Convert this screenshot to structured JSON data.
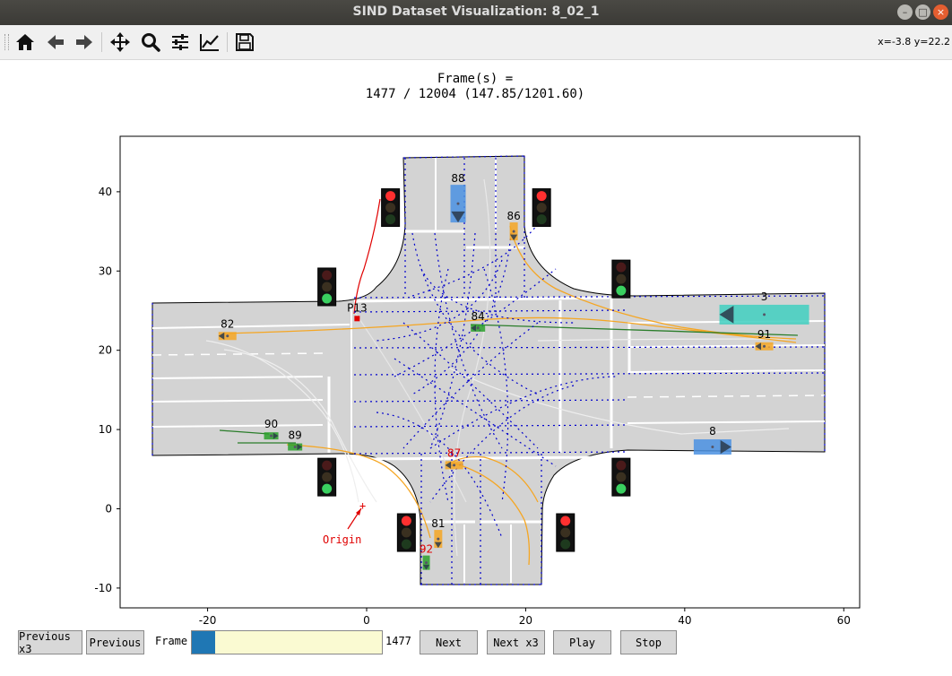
{
  "window": {
    "title": "SIND Dataset Visualization: 8_02_1"
  },
  "toolbar": {
    "tools": [
      {
        "name": "home-icon"
      },
      {
        "name": "back-icon"
      },
      {
        "name": "forward-icon"
      },
      {
        "name": "pan-icon"
      },
      {
        "name": "zoom-icon"
      },
      {
        "name": "configure-subplots-icon"
      },
      {
        "name": "edit-axis-icon"
      },
      {
        "name": "save-icon"
      }
    ],
    "coords": "x=-3.8 y=22.2"
  },
  "plot": {
    "title_line1": "Frame(s) =",
    "title_line2": "1477 / 12004 (147.85/1201.60)",
    "xlim": [
      -31,
      62
    ],
    "ylim": [
      -12.5,
      47
    ],
    "xticks": [
      "-20",
      "0",
      "20",
      "40",
      "60"
    ],
    "yticks": [
      "40",
      "30",
      "20",
      "10",
      "0",
      "-10"
    ],
    "origin_label": "Origin",
    "colors": {
      "car": "#4a90e2",
      "truck": "#40cfc0",
      "moto": "#f5a623",
      "bike": "#2ca02c",
      "ped": "#e00000",
      "road": "#d3d3d3",
      "lane": "#0000cc"
    },
    "vehicles": [
      {
        "id": "88",
        "x": 11.5,
        "y": 38.5,
        "type": "car",
        "dir": "down"
      },
      {
        "id": "86",
        "x": 18.5,
        "y": 35,
        "type": "moto",
        "dir": "down"
      },
      {
        "id": "3",
        "x": 50,
        "y": 24.5,
        "type": "truck",
        "dir": "left"
      },
      {
        "id": "91",
        "x": 50,
        "y": 20.5,
        "type": "moto",
        "dir": "left"
      },
      {
        "id": "84",
        "x": 14,
        "y": 22.8,
        "type": "bike",
        "dir": "left"
      },
      {
        "id": "82",
        "x": -17.5,
        "y": 21.8,
        "type": "moto",
        "dir": "left"
      },
      {
        "id": "P13",
        "x": -1.2,
        "y": 24,
        "type": "ped",
        "dir": "none"
      },
      {
        "id": "90",
        "x": -12,
        "y": 9.2,
        "type": "bike",
        "dir": "right"
      },
      {
        "id": "89",
        "x": -9,
        "y": 7.8,
        "type": "bike",
        "dir": "right"
      },
      {
        "id": "87",
        "x": 11,
        "y": 5.5,
        "type": "moto",
        "dir": "left"
      },
      {
        "id": "8",
        "x": 43.5,
        "y": 7.8,
        "type": "car",
        "dir": "right"
      },
      {
        "id": "81",
        "x": 9,
        "y": -3.8,
        "type": "moto",
        "dir": "down"
      },
      {
        "id": "92",
        "x": 7.5,
        "y": -6.8,
        "type": "bike",
        "dir": "down"
      }
    ],
    "lights": [
      {
        "x": 3,
        "y": 38,
        "state": "red"
      },
      {
        "x": 22,
        "y": 38,
        "state": "red"
      },
      {
        "x": -5,
        "y": 28,
        "state": "green"
      },
      {
        "x": 32,
        "y": 29,
        "state": "green"
      },
      {
        "x": -5,
        "y": 4,
        "state": "green"
      },
      {
        "x": 32,
        "y": 4,
        "state": "green"
      },
      {
        "x": 5,
        "y": -3,
        "state": "red"
      },
      {
        "x": 25,
        "y": -3,
        "state": "red"
      }
    ]
  },
  "controls": {
    "prev3": "Previous x3",
    "prev": "Previous",
    "frame_label": "Frame",
    "frame_value": "1477",
    "frame_fraction": 0.123,
    "next": "Next",
    "next3": "Next x3",
    "play": "Play",
    "stop": "Stop"
  }
}
